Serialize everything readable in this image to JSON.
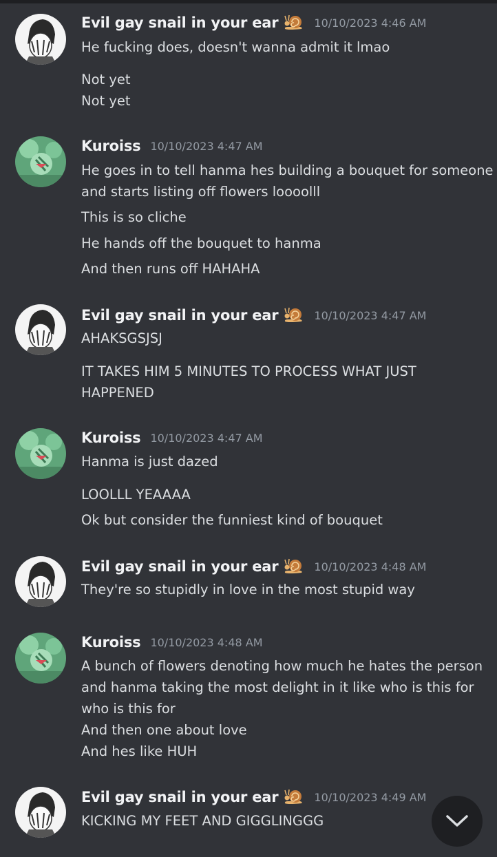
{
  "messages": [
    {
      "author": "Evil gay snail in your ear",
      "timestamp": "10/10/2023 4:46 AM",
      "avatar": "snail-user-avatar",
      "lines": [
        "He fucking does, doesn't wanna admit it lmao",
        "Not yet",
        "Not yet"
      ]
    },
    {
      "author": "Kuroiss",
      "timestamp": "10/10/2023 4:47 AM",
      "avatar": "kuroiss-avatar",
      "lines": [
        "He goes in to tell hanma hes building a bouquet for someone",
        "and starts listing off flowers loooolll",
        "This is so cliche",
        "He hands off the bouquet to hanma",
        "And then runs off HAHAHA"
      ]
    },
    {
      "author": "Evil gay snail in your ear",
      "timestamp": "10/10/2023 4:47 AM",
      "avatar": "snail-user-avatar",
      "lines": [
        "AHAKSGSJSJ",
        "IT TAKES HIM 5 MINUTES TO PROCESS WHAT JUST",
        "HAPPENED"
      ]
    },
    {
      "author": "Kuroiss",
      "timestamp": "10/10/2023 4:47 AM",
      "avatar": "kuroiss-avatar",
      "lines": [
        "Hanma is just dazed",
        "LOOLLL YEAAAA",
        "Ok but consider the funniest kind of bouquet"
      ]
    },
    {
      "author": "Evil gay snail in your ear",
      "timestamp": "10/10/2023 4:48 AM",
      "avatar": "snail-user-avatar",
      "lines": [
        "They're so stupidly in love in the most stupid way"
      ]
    },
    {
      "author": "Kuroiss",
      "timestamp": "10/10/2023 4:48 AM",
      "avatar": "kuroiss-avatar",
      "lines": [
        "A bunch of flowers denoting how much he hates the person",
        "and hanma taking the most delight in it like who is this for",
        "who is this for",
        "And then one about love",
        "And hes like HUH"
      ]
    },
    {
      "author": "Evil gay snail in your ear",
      "timestamp": "10/10/2023 4:49 AM",
      "avatar": "snail-user-avatar",
      "lines": [
        "KICKING MY FEET AND GIGGLINGGG"
      ]
    }
  ],
  "author_emoji": "snail-icon",
  "scroll_button_icon": "chevron-down-icon",
  "colors": {
    "background": "#313338",
    "author": "#f2f3f5",
    "text": "#dbdee1",
    "timestamp": "#949ba4"
  }
}
